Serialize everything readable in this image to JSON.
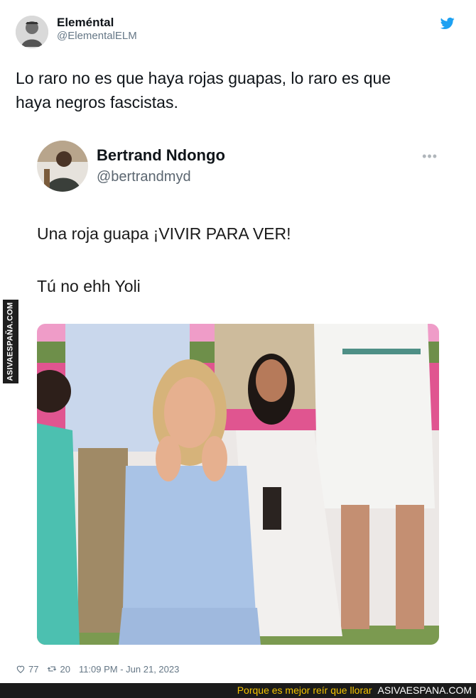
{
  "tweet": {
    "author_name": "Eleméntal",
    "author_handle": "@ElementalELM",
    "text_lines": [
      "Lo raro no es que haya rojas guapas, lo raro es que",
      "haya negros fascistas."
    ],
    "likes": "77",
    "retweets": "20",
    "timestamp": "11:09 PM - Jun 21, 2023"
  },
  "quoted": {
    "author_name": "Bertrand Ndongo",
    "author_handle": "@bertrandmyd",
    "line1": "Una roja guapa ¡VIVIR PARA VER!",
    "line2": "Tú no ehh Yoli",
    "more_glyph": "•••"
  },
  "watermark": {
    "side_label": "ASIVAESPAÑA.COM",
    "tagline": "Porque es mejor reír que llorar",
    "site": "ASIVAESPANA.COM"
  },
  "colors": {
    "twitter_blue": "#1da1f2",
    "banner_bg": "#1b1b1b",
    "tagline_yellow": "#f5c400"
  },
  "icons": [
    "avatar",
    "twitter-bird-icon",
    "heart-icon",
    "retweet-icon",
    "more-icon"
  ]
}
